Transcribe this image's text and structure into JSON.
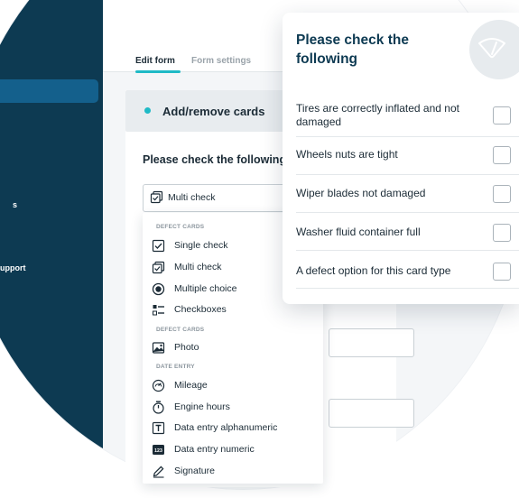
{
  "sidebar": {
    "fragment_a": "s",
    "fragment_b": "upport"
  },
  "tabs": [
    {
      "label": "Edit form",
      "active": true
    },
    {
      "label": "Form settings",
      "active": false
    }
  ],
  "panel": {
    "title": "Add/remove cards",
    "section_title": "Please check the following"
  },
  "card_type_select": {
    "value": "Multi check",
    "icon": "multi-check-icon"
  },
  "dropdown": {
    "groups": [
      {
        "label": "DEFECT CARDS",
        "items": [
          {
            "label": "Single check",
            "icon": "single-check-icon"
          },
          {
            "label": "Multi check",
            "icon": "multi-check-icon"
          },
          {
            "label": "Multiple choice",
            "icon": "radio-icon"
          },
          {
            "label": "Checkboxes",
            "icon": "checkbox-list-icon"
          }
        ]
      },
      {
        "label": "DEFECT CARDS",
        "items": [
          {
            "label": "Photo",
            "icon": "photo-icon"
          }
        ]
      },
      {
        "label": "DATE ENTRY",
        "items": [
          {
            "label": "Mileage",
            "icon": "gauge-icon"
          },
          {
            "label": "Engine hours",
            "icon": "timer-icon"
          },
          {
            "label": "Data entry alphanumeric",
            "icon": "text-box-icon"
          },
          {
            "label": "Data entry numeric",
            "icon": "numeric-icon",
            "icon_text": "123"
          },
          {
            "label": "Signature",
            "icon": "pen-icon"
          }
        ]
      }
    ]
  },
  "preview_card": {
    "title": "Please check the following",
    "badge_icon": "wiper-icon",
    "items": [
      {
        "label": "Tires are correctly inflated and not damaged",
        "checked": false
      },
      {
        "label": "Wheels nuts are tight",
        "checked": false
      },
      {
        "label": "Wiper blades not damaged",
        "checked": false
      },
      {
        "label": "Washer fluid container full",
        "checked": false
      },
      {
        "label": "A defect option for this card type",
        "checked": false
      }
    ]
  },
  "colors": {
    "sidebar": "#0d3a52",
    "accent": "#1fbac6",
    "text": "#1b2b36"
  }
}
